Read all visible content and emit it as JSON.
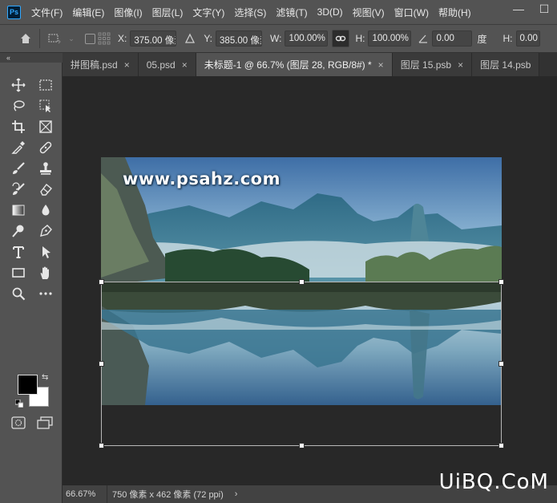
{
  "app": {
    "logo": "Ps"
  },
  "menu": [
    "文件(F)",
    "编辑(E)",
    "图像(I)",
    "图层(L)",
    "文字(Y)",
    "选择(S)",
    "滤镜(T)",
    "3D(D)",
    "视图(V)",
    "窗口(W)",
    "帮助(H)"
  ],
  "window_controls": {
    "minimize": "—",
    "maximize": "☐"
  },
  "options": {
    "x_label": "X:",
    "x_value": "375.00 像素",
    "y_label": "Y:",
    "y_value": "385.00 像素",
    "w_label": "W:",
    "w_value": "100.00%",
    "h_label": "H:",
    "h_value": "100.00%",
    "angle_value": "0.00",
    "angle_unit": "度",
    "h2_label": "H:",
    "h2_value": "0.00"
  },
  "toolbox_collapse": "«",
  "tabs": [
    {
      "label": "拼图稿.psd",
      "close": "×"
    },
    {
      "label": "05.psd",
      "close": "×"
    },
    {
      "label": "未标题-1 @ 66.7% (图层 28, RGB/8#) *",
      "close": "×",
      "active": true
    },
    {
      "label": "图层 15.psb",
      "close": "×"
    },
    {
      "label": "图层 14.psb",
      "close": ""
    }
  ],
  "canvas": {
    "watermark": "www.psahz.com"
  },
  "status": {
    "zoom": "66.67%",
    "doc_info": "750 像素 x 462 像素 (72 ppi)",
    "arrow": "›"
  },
  "brand": "UiBQ.CoM",
  "colors": {
    "foreground": "#000000",
    "background": "#ffffff",
    "accent": "#31a8ff"
  }
}
